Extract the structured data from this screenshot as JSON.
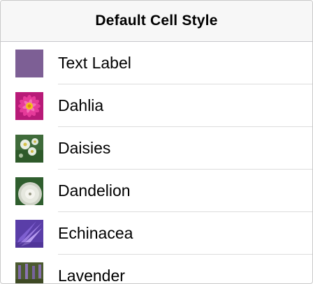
{
  "navbar": {
    "title": "Default Cell Style"
  },
  "cells": [
    {
      "label": "Text Label",
      "icon": "purple-swatch-icon"
    },
    {
      "label": "Dahlia",
      "icon": "dahlia-photo-icon"
    },
    {
      "label": "Daisies",
      "icon": "daisies-photo-icon"
    },
    {
      "label": "Dandelion",
      "icon": "dandelion-photo-icon"
    },
    {
      "label": "Echinacea",
      "icon": "echinacea-photo-icon"
    },
    {
      "label": "Lavender",
      "icon": "lavender-photo-icon"
    }
  ],
  "colors": {
    "navbar_bg": "#f7f7f7",
    "separator": "#dcdcdc",
    "swatch": "#7a5c92"
  }
}
